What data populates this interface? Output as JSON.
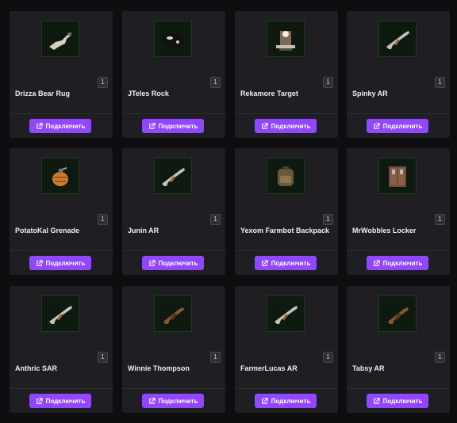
{
  "button_label": "Подключить",
  "accent_color": "#9147ff",
  "items": [
    {
      "name": "Drizza Bear Rug",
      "count": "1",
      "icon": "bear-rug-icon"
    },
    {
      "name": "JTeles Rock",
      "count": "1",
      "icon": "rock-icon"
    },
    {
      "name": "Rekamore Target",
      "count": "1",
      "icon": "target-icon"
    },
    {
      "name": "Spinky AR",
      "count": "1",
      "icon": "rifle-icon"
    },
    {
      "name": "PotatoKal Grenade",
      "count": "1",
      "icon": "grenade-icon"
    },
    {
      "name": "Junin AR",
      "count": "1",
      "icon": "rifle-icon"
    },
    {
      "name": "Yexom Farmbot Backpack",
      "count": "1",
      "icon": "backpack-icon"
    },
    {
      "name": "MrWobbles Locker",
      "count": "1",
      "icon": "locker-icon"
    },
    {
      "name": "Anthric SAR",
      "count": "1",
      "icon": "rifle-icon"
    },
    {
      "name": "Winnie Thompson",
      "count": "1",
      "icon": "smg-icon"
    },
    {
      "name": "FarmerLucas AR",
      "count": "1",
      "icon": "rifle-icon"
    },
    {
      "name": "Tabsy AR",
      "count": "1",
      "icon": "smg-icon"
    }
  ]
}
